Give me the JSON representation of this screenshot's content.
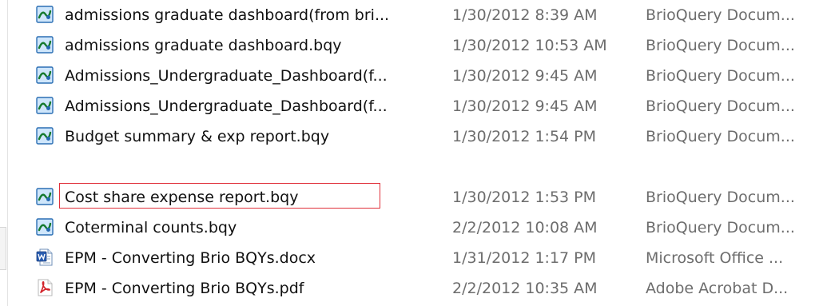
{
  "files": [
    {
      "name": "admissions graduate dashboard(from bri...",
      "date": "1/30/2012 8:39 AM",
      "type": "BrioQuery Docum...",
      "icon": "brio-icon"
    },
    {
      "name": "admissions graduate dashboard.bqy",
      "date": "1/30/2012 10:53 AM",
      "type": "BrioQuery Docum...",
      "icon": "brio-icon"
    },
    {
      "name": "Admissions_Undergraduate_Dashboard(f...",
      "date": "1/30/2012 9:45 AM",
      "type": "BrioQuery Docum...",
      "icon": "brio-icon"
    },
    {
      "name": "Admissions_Undergraduate_Dashboard(f...",
      "date": "1/30/2012 9:45 AM",
      "type": "BrioQuery Docum...",
      "icon": "brio-icon"
    },
    {
      "name": "Budget summary & exp report.bqy",
      "date": "1/30/2012 1:54 PM",
      "type": "BrioQuery Docum...",
      "icon": "brio-icon"
    },
    {
      "name": "Cost share expense report.bqy",
      "date": "1/30/2012 1:53 PM",
      "type": "BrioQuery Docum...",
      "icon": "brio-icon"
    },
    {
      "name": "Coterminal counts.bqy",
      "date": "2/2/2012 10:08 AM",
      "type": "BrioQuery Docum...",
      "icon": "brio-icon"
    },
    {
      "name": "EPM - Converting Brio BQYs.docx",
      "date": "1/31/2012 1:17 PM",
      "type": "Microsoft Office ...",
      "icon": "word-doc-icon"
    },
    {
      "name": "EPM - Converting Brio BQYs.pdf",
      "date": "2/2/2012 10:35 AM",
      "type": "Adobe Acrobat D...",
      "icon": "pdf-icon"
    }
  ],
  "highlight_color": "#e0303a"
}
